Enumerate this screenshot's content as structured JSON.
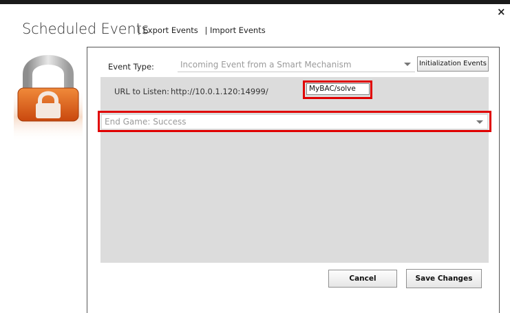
{
  "window": {
    "close_glyph": "×"
  },
  "header": {
    "title": "Scheduled Events",
    "export_link": "| Export Events",
    "import_link": "| Import Events"
  },
  "lock_image": {
    "icon": "padlock-icon",
    "colors": {
      "body": "#e0621c",
      "shackle": "#c9c9c9"
    }
  },
  "form": {
    "event_type_label": "Event Type:",
    "event_type_value": "Incoming Event from a Smart Mechanism",
    "init_button": "Initialization Events",
    "url_label": "URL to Listen:",
    "url_value": "http://10.0.1.120:14999/",
    "path_value": "MyBAC/solve",
    "end_select_value": "End Game: Success"
  },
  "footer": {
    "cancel_label": "Cancel",
    "save_label": "Save Changes"
  },
  "colors": {
    "highlight": "#e00000",
    "panel_gray": "#dcdcdc"
  }
}
